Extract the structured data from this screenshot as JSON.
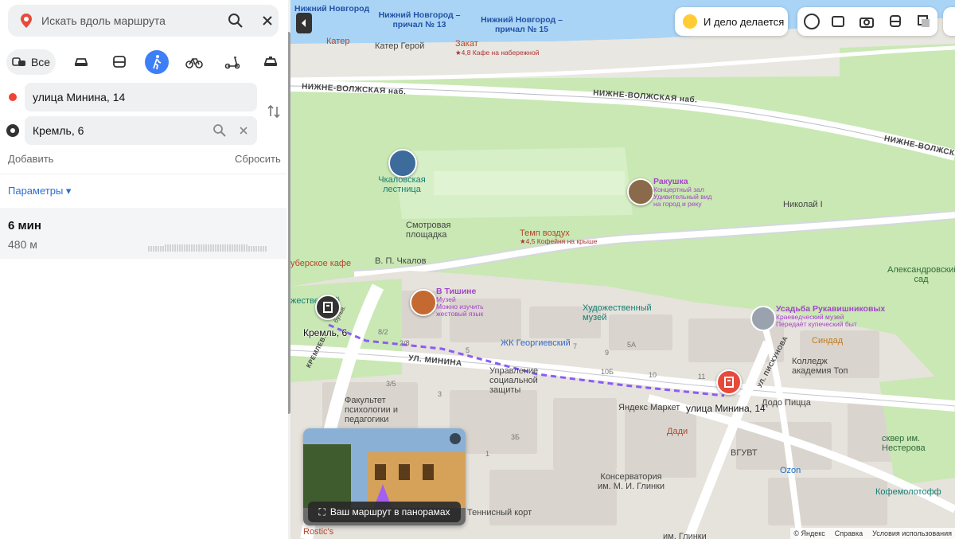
{
  "search": {
    "placeholder": "Искать вдоль маршрута"
  },
  "modes": {
    "all_label": "Все"
  },
  "route": {
    "from": "улица Минина, 14",
    "to": "Кремль, 6",
    "add_label": "Добавить",
    "reset_label": "Сбросить",
    "params_label": "Параметры ▾",
    "time": "6 мин",
    "distance": "480 м"
  },
  "promo": {
    "label": "И дело делается"
  },
  "panorama": {
    "label": "Ваш маршрут в панорамах"
  },
  "footer": {
    "copyright": "© Яндекс",
    "help": "Справка",
    "terms": "Условия использования"
  },
  "map": {
    "streets": [
      "НИЖНЕ-ВОЛЖСКАЯ наб.",
      "НИЖНЕ-ВОЛЖСКАЯ наб.",
      "НИЖНЕ-ВОЛЖСК",
      "УЛ. МИНИНА",
      "УЛ. ПИСКУНОВА",
      "КРЕМЛЕВ.",
      "бульв."
    ],
    "places": {
      "pier13": "Нижний Новгород – причал № 13",
      "pier15": "Нижний Новгород – причал № 15",
      "pier_top": "Нижний Новгород",
      "kater": "Катер",
      "kater_geroy": "Катер Герой",
      "zakat": "Закат",
      "zakat_sub": "★4,8 Кафе на набережной",
      "chkalov_stairs": "Чкаловская лестница",
      "rakushka": "Ракушка",
      "rakushka_sub1": "Концертный зал",
      "rakushka_sub2": "Удивительный вид",
      "rakushka_sub3": "на город и реку",
      "nikolay": "Николай I",
      "observation": "Смотровая площадка",
      "temp": "Темп воздух",
      "temp_sub": "★4,5 Кофейня на крыше",
      "chkalov": "В. П. Чкалов",
      "cafe": "уберское кафе",
      "alexandr_garden": "Александровский сад",
      "tishina": "В Тишине",
      "tishina_sub1": "Музей",
      "tishina_sub2": "Можно изучить",
      "tishina_sub3": "жестовый язык",
      "art_museum": "Художественный музей",
      "usadba": "Усадьба Рукавишниковых",
      "usadba_sub1": "Краеведческий музей",
      "usadba_sub2": "Передаёт купеческий быт",
      "georgievsky": "ЖК Георгиевский",
      "sindad": "Синдад",
      "college": "Колледж академия Топ",
      "social": "Управление социальной защиты",
      "yandex_market": "Яндекс Маркет",
      "dodo": "Додо Пицца",
      "faculty": "Факультет психологии и педагогики",
      "dadi": "Дади",
      "vgutv": "ВГУВТ",
      "ozon": "Ozon",
      "conservatory": "Консерватория им. М. И. Глинки",
      "kofemolotoff": "Кофемолотофф",
      "skver": "сквер им. Нестерова",
      "tennis": "Теннисный корт",
      "rostics": "Rostic's",
      "kremlin_marker": "Кремль, 6",
      "minina_marker": "улица Минина, 14",
      "tvestvennyi": "жественный",
      "bottom_cut": "им. Глинки"
    },
    "house_numbers": [
      "8/2",
      "2/8",
      "5",
      "3/5",
      "3",
      "10Б",
      "7",
      "9",
      "5А",
      "10",
      "11",
      "3Б",
      "1",
      "4",
      "16",
      "21",
      "18",
      "19",
      "20",
      "5Б",
      "13",
      "2А",
      "3Б",
      "4Б"
    ]
  },
  "colors": {
    "accent": "#3d7ff6",
    "route": "#8a5cf5",
    "pin_red": "#e64a3b",
    "water": "#a9d4f5",
    "park": "#c9e8b4"
  }
}
